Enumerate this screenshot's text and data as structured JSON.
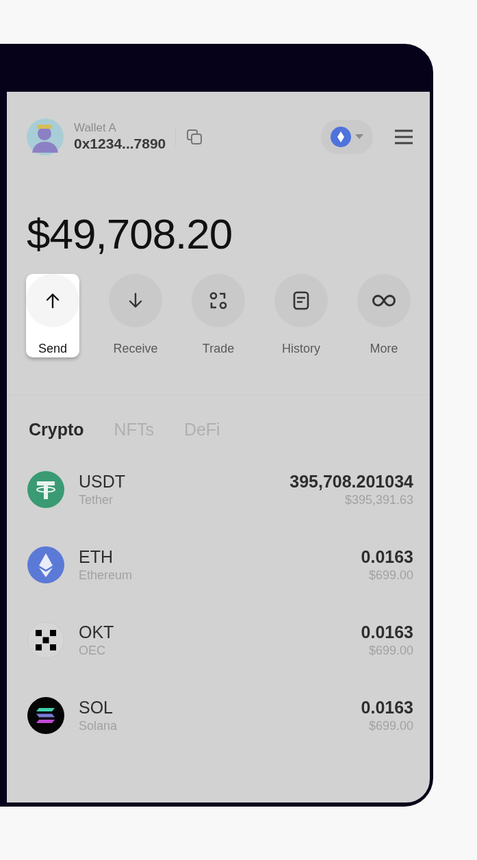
{
  "wallet": {
    "name": "Wallet A",
    "address": "0x1234...7890"
  },
  "balance": "$49,708.20",
  "actions": [
    {
      "kind": "send",
      "label": "Send",
      "highlighted": true
    },
    {
      "kind": "receive",
      "label": "Receive",
      "highlighted": false
    },
    {
      "kind": "trade",
      "label": "Trade",
      "highlighted": false
    },
    {
      "kind": "history",
      "label": "History",
      "highlighted": false
    },
    {
      "kind": "more",
      "label": "More",
      "highlighted": false
    }
  ],
  "tabs": [
    {
      "label": "Crypto",
      "selected": true
    },
    {
      "label": "NFTs",
      "selected": false
    },
    {
      "label": "DeFi",
      "selected": false
    }
  ],
  "assets": [
    {
      "kind": "tether",
      "symbol": "USDT",
      "name": "Tether",
      "amount": "395,708.201034",
      "value": "$395,391.63"
    },
    {
      "kind": "ethereum",
      "symbol": "ETH",
      "name": "Ethereum",
      "amount": "0.0163",
      "value": "$699.00"
    },
    {
      "kind": "okt",
      "symbol": "OKT",
      "name": "OEC",
      "amount": "0.0163",
      "value": "$699.00"
    },
    {
      "kind": "solana",
      "symbol": "SOL",
      "name": "Solana",
      "amount": "0.0163",
      "value": "$699.00"
    }
  ]
}
